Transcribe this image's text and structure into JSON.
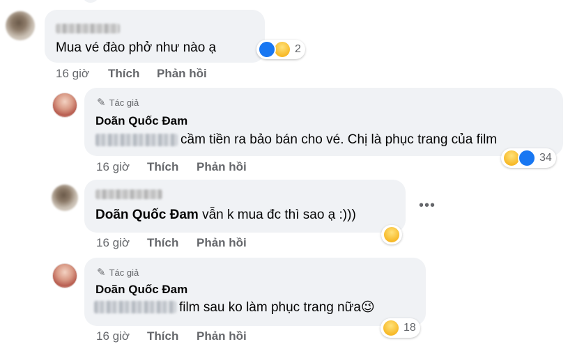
{
  "comments": [
    {
      "text": "Mua vé đào phở như nào ạ",
      "time": "16 giờ",
      "like_label": "Thích",
      "reply_label": "Phản hồi",
      "reaction_count": "2"
    },
    {
      "author_tag": "Tác giả",
      "author": "Doãn Quốc Đam",
      "text": "cầm tiền ra bảo bán cho vé. Chị là phục trang của film",
      "time": "16 giờ",
      "like_label": "Thích",
      "reply_label": "Phản hồi",
      "reaction_count": "34"
    },
    {
      "mention": "Doãn Quốc Đam",
      "text": "vẫn k mua đc thì sao ạ :)))",
      "time": "16 giờ",
      "like_label": "Thích",
      "reply_label": "Phản hồi",
      "more_label": "•••"
    },
    {
      "author_tag": "Tác giả",
      "author": "Doãn Quốc Đam",
      "text": "film sau ko làm phục trang nữa",
      "emoji": "😉",
      "time": "16 giờ",
      "like_label": "Thích",
      "reply_label": "Phản hồi",
      "reaction_count": "18"
    }
  ],
  "icons": {
    "pen": "✎",
    "haha": "😆",
    "like": "👍"
  },
  "colors": {
    "bubble": "#f0f2f5",
    "meta": "#65676b",
    "like_blue": "#1877f2",
    "haha_yellow": "#f7b928"
  }
}
